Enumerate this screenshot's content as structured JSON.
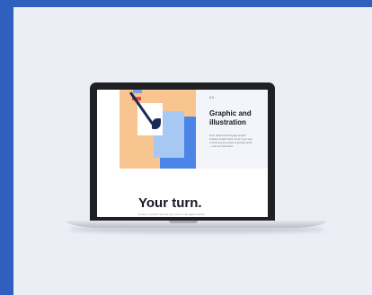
{
  "card": {
    "meta": "03",
    "title": "Graphic and illustration",
    "body": "From self-Portrait? Engage people? Creative creatio? Each one of it your step to becoming the creator to illustrate artist! — pick your tips below."
  },
  "hero": {
    "heading": "Your turn.",
    "subtext": "Ready to create? Submit your work to the gallery below."
  },
  "colors": {
    "background": "#2f5fbf",
    "frame": "#eceef6",
    "art_peach": "#f8c48f",
    "art_blue": "#4d84e8",
    "art_light_blue": "#a8c8f4",
    "ink": "#1b2a55"
  }
}
